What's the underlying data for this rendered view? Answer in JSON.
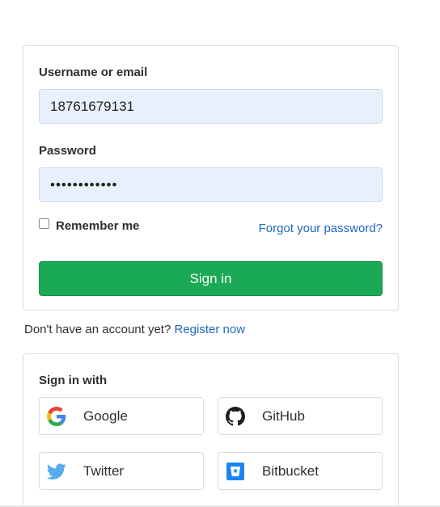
{
  "login_form": {
    "username_label": "Username or email",
    "username_value": "18761679131",
    "password_label": "Password",
    "password_value": "••••••••••••",
    "remember_label": "Remember me",
    "remember_checked": false,
    "forgot_link": "Forgot your password?",
    "signin_button": "Sign in"
  },
  "register": {
    "prompt": "Don't have an account yet?",
    "link": "Register now"
  },
  "social": {
    "title": "Sign in with",
    "providers": [
      {
        "label": "Google",
        "icon": "google-icon"
      },
      {
        "label": "GitHub",
        "icon": "github-icon"
      },
      {
        "label": "Twitter",
        "icon": "twitter-icon"
      },
      {
        "label": "Bitbucket",
        "icon": "bitbucket-icon"
      }
    ]
  },
  "colors": {
    "primary_button": "#1aaa55",
    "link": "#1f69c0",
    "input_fill": "#e8f0fe"
  }
}
